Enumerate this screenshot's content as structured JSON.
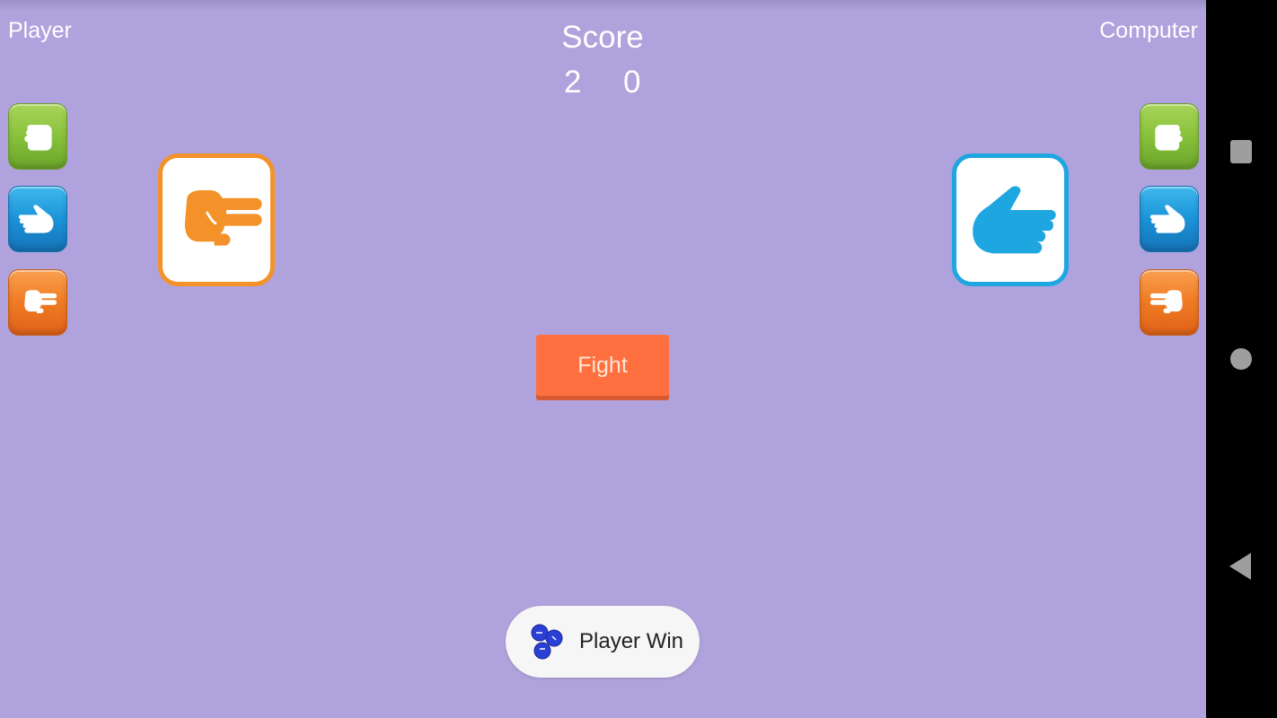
{
  "labels": {
    "player": "Player",
    "computer": "Computer"
  },
  "score": {
    "title": "Score",
    "player": "2",
    "computer": "0"
  },
  "choices": [
    {
      "name": "rock",
      "icon": "rock-fist-icon",
      "color": "#8cc43e"
    },
    {
      "name": "paper",
      "icon": "paper-hand-icon",
      "color": "#1b93d8"
    },
    {
      "name": "scissors",
      "icon": "scissors-hand-icon",
      "color": "#ef7b22"
    }
  ],
  "current": {
    "player_choice": "scissors",
    "computer_choice": "paper"
  },
  "colors": {
    "background": "#b0a2dc",
    "fight_button": "#ff7040",
    "scissors_accent": "#f4922a",
    "paper_accent": "#1ea6e0"
  },
  "buttons": {
    "fight": "Fight"
  },
  "toast": {
    "message": "Player Win",
    "icon": "app-icon"
  },
  "navbar": {
    "recent": "recent-apps-icon",
    "home": "home-icon",
    "back": "back-icon"
  }
}
